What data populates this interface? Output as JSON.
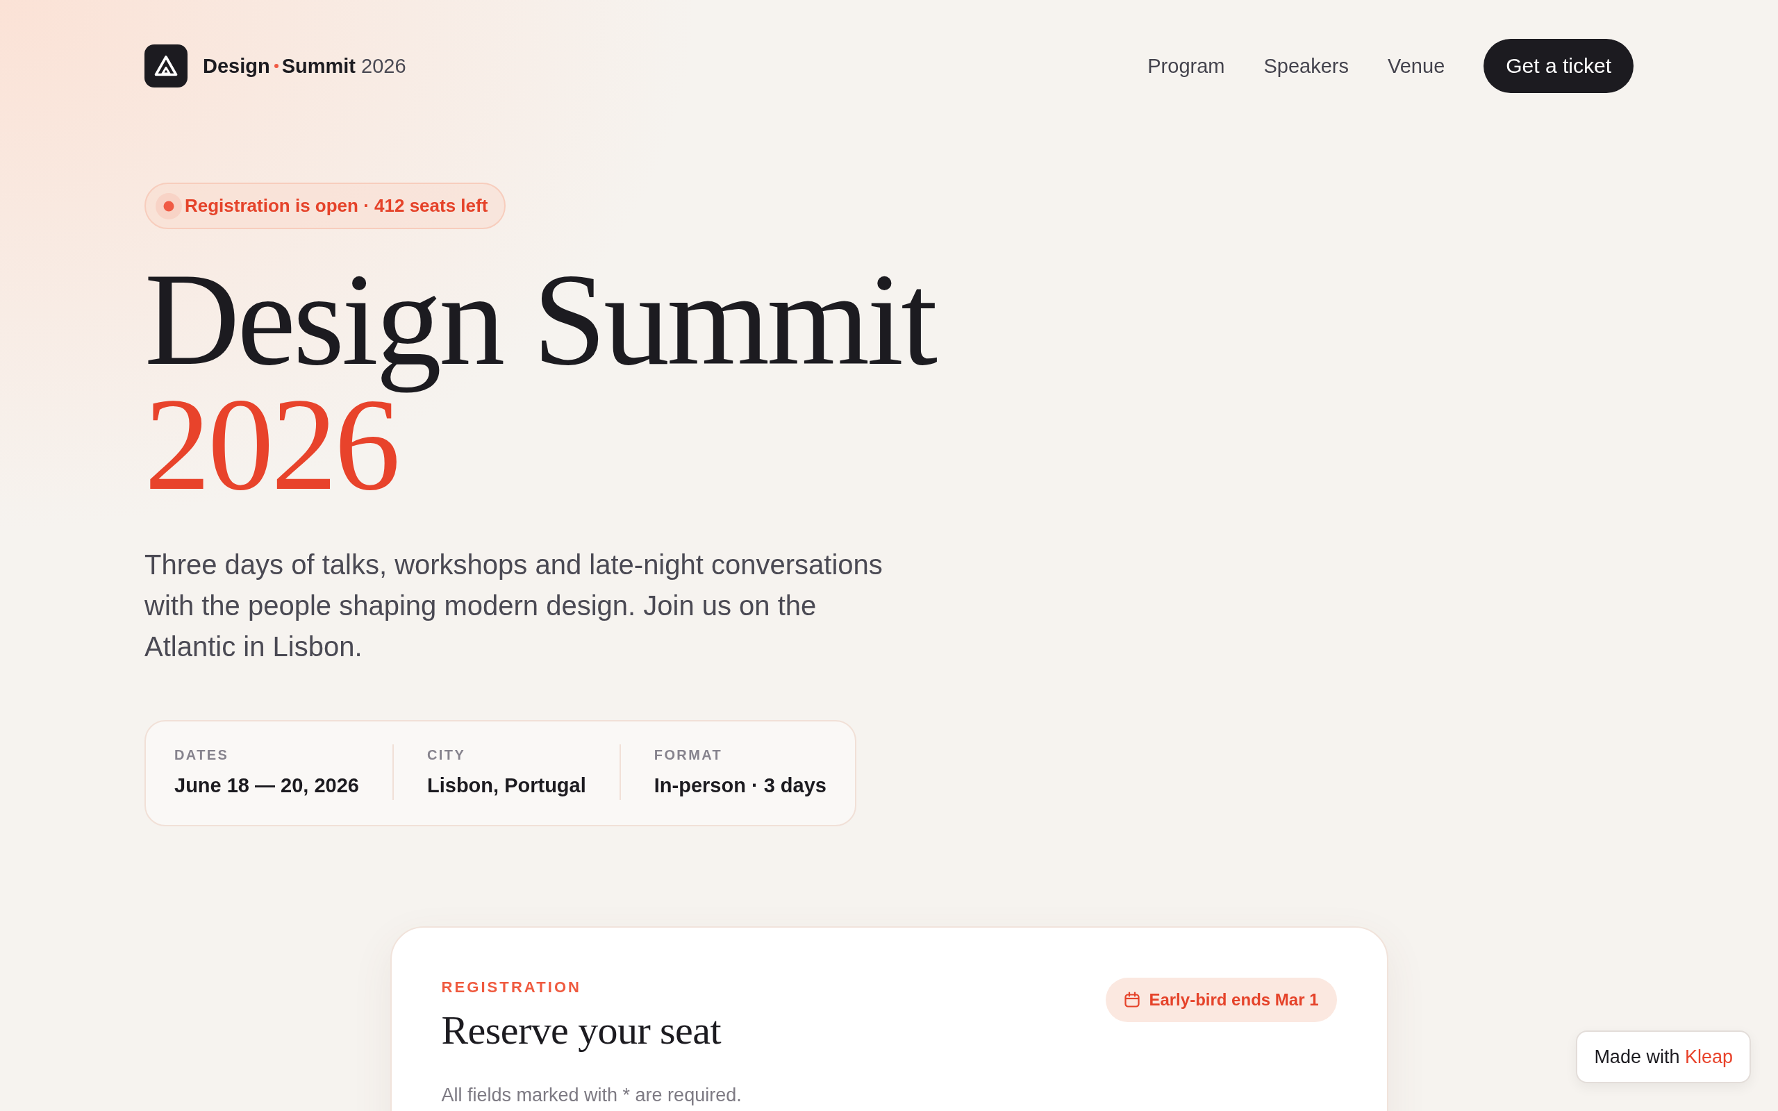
{
  "brand": {
    "name": "Design",
    "tagline": "**Summit** 2026"
  },
  "nav": {
    "links": [
      "Program",
      "Speakers",
      "Venue"
    ],
    "cta": "Get a ticket"
  },
  "hero": {
    "status": "Registration is open · 412 seats left",
    "title": "Design Summit",
    "year": "2026",
    "lead": "Three days of talks, workshops and late-night conversations with the people shaping modern design. Join us on the Atlantic in Lisbon."
  },
  "facts": [
    {
      "label": "DATES",
      "value": "June 18 — 20, 2026"
    },
    {
      "label": "CITY",
      "value": "Lisbon, Portugal"
    },
    {
      "label": "FORMAT",
      "value": "In-person · 3 days"
    }
  ],
  "registration": {
    "eyebrow": "REGISTRATION",
    "title": "Reserve your seat",
    "deadline": "Early-bird ends Mar 1",
    "note": "All fields marked with * are required."
  },
  "made_with": {
    "label": "Made with",
    "brand": "Kleap"
  }
}
